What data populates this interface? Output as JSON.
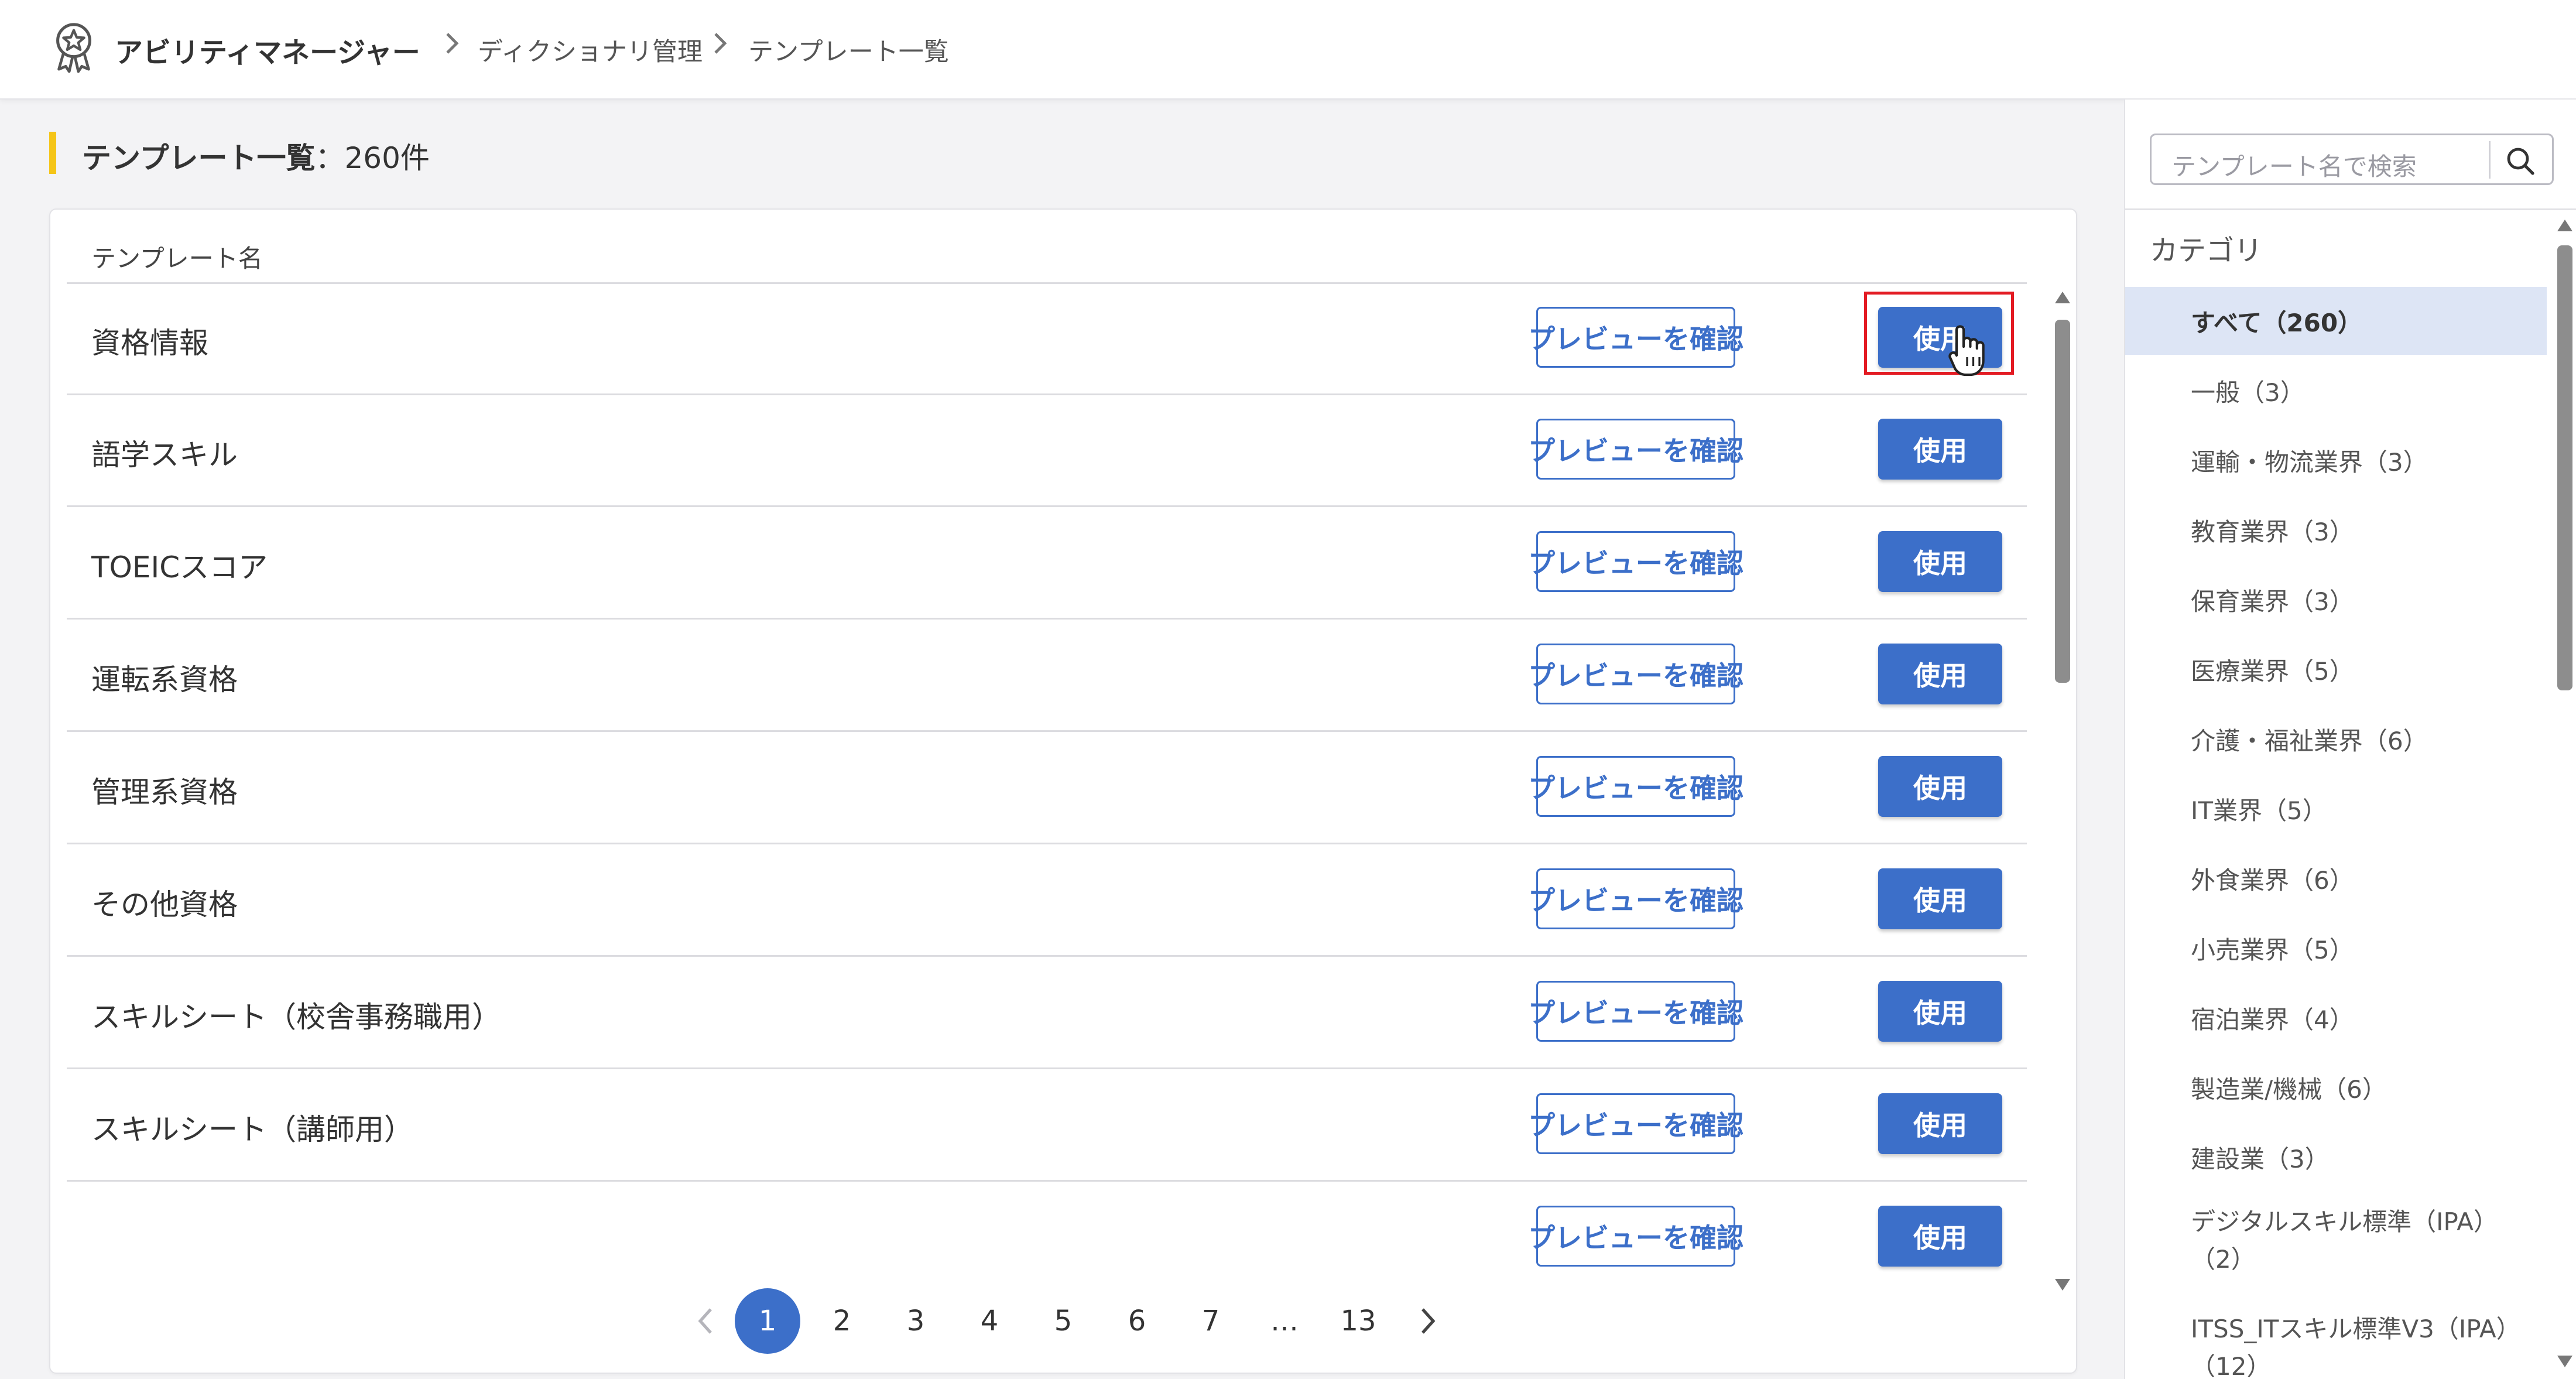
{
  "app": {
    "title": "アビリティマネージャー"
  },
  "breadcrumb": [
    "ディクショナリ管理",
    "テンプレート一覧"
  ],
  "page": {
    "title": "テンプレート一覧",
    "separator": "：",
    "count": "260件"
  },
  "table": {
    "header": "テンプレート名",
    "preview_label": "プレビューを確認",
    "use_label": "使用",
    "rows": [
      "資格情報",
      "語学スキル",
      "TOEICスコア",
      "運転系資格",
      "管理系資格",
      "その他資格",
      "スキルシート（校舎事務職用）",
      "スキルシート（講師用）",
      ""
    ]
  },
  "pagination": {
    "pages": [
      "1",
      "2",
      "3",
      "4",
      "5",
      "6",
      "7",
      "…",
      "13"
    ],
    "current": "1"
  },
  "search": {
    "placeholder": "テンプレート名で検索"
  },
  "categories": {
    "title": "カテゴリ",
    "items": [
      "すべて（260）",
      "一般（3）",
      "運輸・物流業界（3）",
      "教育業界（3）",
      "保育業界（3）",
      "医療業界（5）",
      "介護・福祉業界（6）",
      "IT業界（5）",
      "外食業界（6）",
      "小売業界（5）",
      "宿泊業界（4）",
      "製造業/機械（6）",
      "建設業（3）",
      "デジタルスキル標準（IPA）\n（2）",
      "ITSS_ITスキル標準V3（IPA）\n（12）"
    ],
    "selected": "すべて（260）"
  },
  "colors": {
    "accent": "#3c6fc9",
    "heading_bar": "#f5c518",
    "highlight": "#e31b23",
    "selected_bg": "#dde5f5"
  }
}
